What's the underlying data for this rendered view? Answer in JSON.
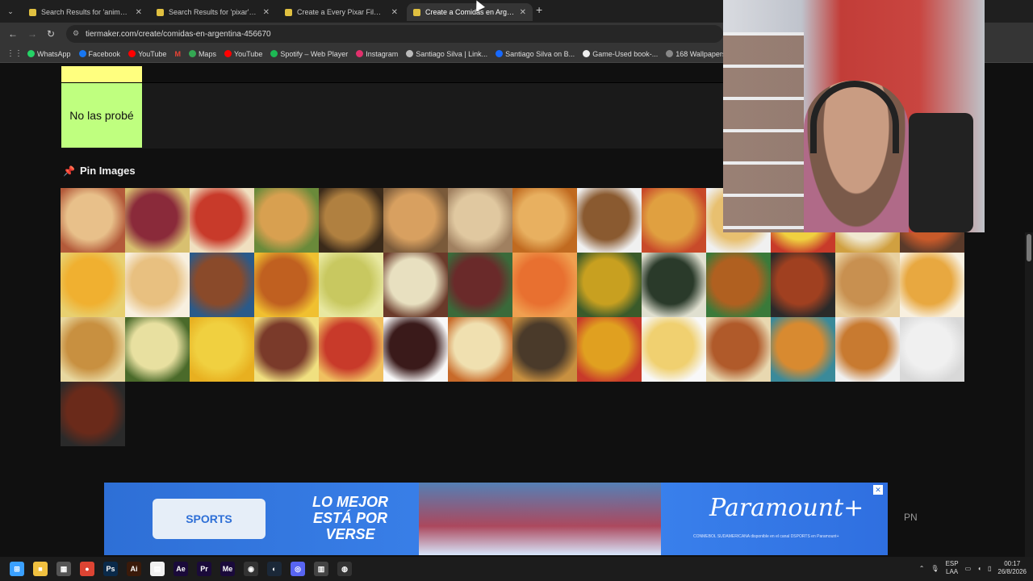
{
  "browser": {
    "tabs": [
      {
        "title": "Search Results for 'anime' - Tie",
        "close": "✕"
      },
      {
        "title": "Search Results for 'pixar' - Tierl",
        "close": "✕"
      },
      {
        "title": "Create a Every Pixar Film (Marc",
        "close": "✕"
      },
      {
        "title": "Create a Comidas en Argentina",
        "close": "✕"
      }
    ],
    "new_tab": "+",
    "url": "tiermaker.com/create/comidas-en-argentina-456670",
    "bookmarks": [
      {
        "label": "WhatsApp",
        "color": "#25d366"
      },
      {
        "label": "Facebook",
        "color": "#1877f2"
      },
      {
        "label": "YouTube",
        "color": "#ff0000"
      },
      {
        "label": "M",
        "color": "#ea4335"
      },
      {
        "label": "Maps",
        "color": "#34a853"
      },
      {
        "label": "YouTube",
        "color": "#ff0000"
      },
      {
        "label": "Spotify – Web Player",
        "color": "#1db954"
      },
      {
        "label": "Instagram",
        "color": "#e1306c"
      },
      {
        "label": "Santiago Silva | Link...",
        "color": "#bbbbbb"
      },
      {
        "label": "Santiago Silva on B...",
        "color": "#1769ff"
      },
      {
        "label": "Game-Used book-...",
        "color": "#eeeeee"
      },
      {
        "label": "168 Wallpapers by...",
        "color": "#888888"
      }
    ]
  },
  "tier": {
    "label": "No las probé",
    "prev_color": "#ffff7f",
    "label_color": "#bfff7f"
  },
  "pin_section": {
    "title": "Pin Images",
    "icon": "pin-icon"
  },
  "images": [
    {
      "name": "food-image-sandwich",
      "c1": "#e8c08a",
      "c2": "#b35a3a"
    },
    {
      "name": "food-image-picada",
      "c1": "#8a2a3a",
      "c2": "#d8c070"
    },
    {
      "name": "food-image-ravioles",
      "c1": "#c83a2a",
      "c2": "#f0e0c0"
    },
    {
      "name": "food-image-empanadas",
      "c1": "#d8a050",
      "c2": "#6a8a3a"
    },
    {
      "name": "food-image-pastel-de-papa",
      "c1": "#b08040",
      "c2": "#3a2a1a"
    },
    {
      "name": "food-image-medialunas",
      "c1": "#d8a060",
      "c2": "#7a5a3a"
    },
    {
      "name": "food-image-alfajor-cake",
      "c1": "#e0c8a0",
      "c2": "#a08060"
    },
    {
      "name": "food-image-bizcochuelo",
      "c1": "#e8b060",
      "c2": "#c06a20"
    },
    {
      "name": "food-image-croquetas",
      "c1": "#8a5a30",
      "c2": "#f0f0f0"
    },
    {
      "name": "food-image-canelones",
      "c1": "#e0a040",
      "c2": "#c84a2a"
    },
    {
      "name": "food-image-locro",
      "c1": "#e8c070",
      "c2": "#f0f0f0"
    },
    {
      "name": "food-image-flan-polenta",
      "c1": "#f0d040",
      "c2": "#c83a2a"
    },
    {
      "name": "food-image-alfajor-maicena",
      "c1": "#f0e8d0",
      "c2": "#d0a040"
    },
    {
      "name": "food-image-guiso",
      "c1": "#c85a2a",
      "c2": "#5a3a2a"
    },
    {
      "name": "food-image-papas-fritas",
      "c1": "#f0b030",
      "c2": "#e8d070"
    },
    {
      "name": "food-image-chipa",
      "c1": "#e8c080",
      "c2": "#f8f0e0"
    },
    {
      "name": "food-image-lentejas",
      "c1": "#8a4a2a",
      "c2": "#2a5a8a"
    },
    {
      "name": "food-image-hamburguesa",
      "c1": "#c06020",
      "c2": "#f0c030"
    },
    {
      "name": "food-image-humita",
      "c1": "#c8c860",
      "c2": "#e8e8a0"
    },
    {
      "name": "food-image-helado",
      "c1": "#e8e0c0",
      "c2": "#6a3a2a"
    },
    {
      "name": "food-image-matambre",
      "c1": "#6a2a2a",
      "c2": "#3a6a3a"
    },
    {
      "name": "food-image-rosquitas",
      "c1": "#e87030",
      "c2": "#f0a050"
    },
    {
      "name": "food-image-locro-verde",
      "c1": "#c8a020",
      "c2": "#3a5a2a"
    },
    {
      "name": "food-image-sushi",
      "c1": "#2a3a2a",
      "c2": "#e0e0d0"
    },
    {
      "name": "food-image-pollo",
      "c1": "#b06020",
      "c2": "#3a7a3a"
    },
    {
      "name": "food-image-albondigas",
      "c1": "#a04020",
      "c2": "#2a2a2a"
    },
    {
      "name": "food-image-pan-casero",
      "c1": "#c89050",
      "c2": "#e8d0a0"
    },
    {
      "name": "food-image-flan",
      "c1": "#e8a840",
      "c2": "#f8f0e0"
    },
    {
      "name": "food-image-milanesa",
      "c1": "#c89040",
      "c2": "#e8d8a0"
    },
    {
      "name": "food-image-noquis",
      "c1": "#e8e0a0",
      "c2": "#4a6a2a"
    },
    {
      "name": "food-image-tortilla",
      "c1": "#f0d040",
      "c2": "#e8b020"
    },
    {
      "name": "food-image-milanesa-napolitana",
      "c1": "#7a3a2a",
      "c2": "#f0e080"
    },
    {
      "name": "food-image-pancho",
      "c1": "#c83a2a",
      "c2": "#f0c060"
    },
    {
      "name": "food-image-postre",
      "c1": "#3a1a1a",
      "c2": "#f8f8f8"
    },
    {
      "name": "food-image-pizza",
      "c1": "#f0e0b0",
      "c2": "#c86a2a"
    },
    {
      "name": "food-image-carne-al-horno",
      "c1": "#4a3a2a",
      "c2": "#c89040"
    },
    {
      "name": "food-image-tacos",
      "c1": "#e0a020",
      "c2": "#c83a2a"
    },
    {
      "name": "food-image-sopa",
      "c1": "#f0d070",
      "c2": "#f8f8f8"
    },
    {
      "name": "food-image-torta-rogel",
      "c1": "#b05a2a",
      "c2": "#e8d8b0"
    },
    {
      "name": "food-image-fideos",
      "c1": "#d88a30",
      "c2": "#3a8a9a"
    },
    {
      "name": "food-image-waffles",
      "c1": "#c87a30",
      "c2": "#f0f0f0"
    },
    {
      "name": "food-image-torta-blanca",
      "c1": "#f0f0f0",
      "c2": "#d8d8d8"
    },
    {
      "name": "food-image-asado",
      "c1": "#6a2a1a",
      "c2": "#2a2a2a"
    }
  ],
  "ad": {
    "brand_left": "SPORTS",
    "slogan": "LO MEJOR ESTÁ POR VERSE",
    "brand_right": "Paramount+",
    "fine_print": "CONMEBOL SUDAMERICANA disponible en el canal DSPORTS en Paramount+",
    "pn_label": "PN",
    "close": "✕"
  },
  "taskbar": {
    "apps": [
      {
        "name": "start-icon",
        "label": "⊞",
        "color": "#3aa0ff"
      },
      {
        "name": "file-explorer-icon",
        "label": "■",
        "color": "#f0c040"
      },
      {
        "name": "store-icon",
        "label": "▦",
        "color": "#555555"
      },
      {
        "name": "chrome-icon",
        "label": "●",
        "color": "#dd4433"
      },
      {
        "name": "photoshop-icon",
        "label": "Ps",
        "color": "#0a2a4a"
      },
      {
        "name": "illustrator-icon",
        "label": "Ai",
        "color": "#3a1a0a"
      },
      {
        "name": "notepad-icon",
        "label": "▤",
        "color": "#f0f0f0"
      },
      {
        "name": "after-effects-icon",
        "label": "Ae",
        "color": "#1a0a3a"
      },
      {
        "name": "premiere-icon",
        "label": "Pr",
        "color": "#1a0a3a"
      },
      {
        "name": "media-encoder-icon",
        "label": "Me",
        "color": "#1a0a3a"
      },
      {
        "name": "app-icon",
        "label": "◉",
        "color": "#333333"
      },
      {
        "name": "steam-icon",
        "label": "◐",
        "color": "#1b2838"
      },
      {
        "name": "discord-icon",
        "label": "◎",
        "color": "#5865f2"
      },
      {
        "name": "calculator-icon",
        "label": "▥",
        "color": "#444444"
      },
      {
        "name": "obs-icon",
        "label": "◍",
        "color": "#333333"
      }
    ],
    "lang": "ESP",
    "lang_sub": "LAA",
    "time": "00:17",
    "date": "26/8/2026"
  }
}
